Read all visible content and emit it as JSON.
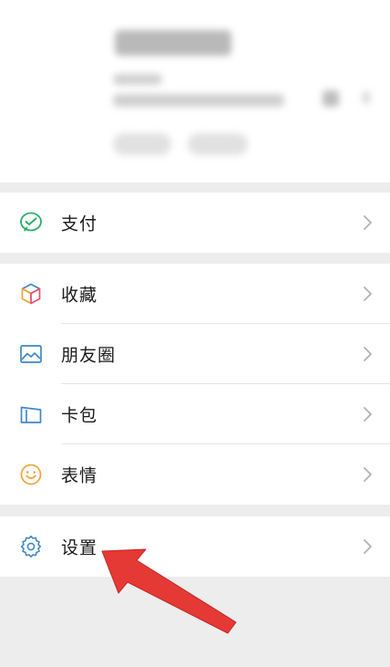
{
  "menu": {
    "pay": {
      "label": "支付",
      "icon": "pay-check-icon"
    },
    "favorites": {
      "label": "收藏",
      "icon": "favorites-cube-icon"
    },
    "moments": {
      "label": "朋友圈",
      "icon": "moments-picture-icon"
    },
    "cards": {
      "label": "卡包",
      "icon": "card-wallet-icon"
    },
    "stickers": {
      "label": "表情",
      "icon": "sticker-smile-icon"
    },
    "settings": {
      "label": "设置",
      "icon": "settings-gear-icon"
    }
  },
  "colors": {
    "page_bg": "#ededed",
    "card_bg": "#ffffff",
    "pay_green": "#2aae67",
    "icon_blue": "#3d88c9",
    "sticker_orange": "#f2a438",
    "arrow_red": "#e53935",
    "chevron": "#b2b2b2"
  }
}
